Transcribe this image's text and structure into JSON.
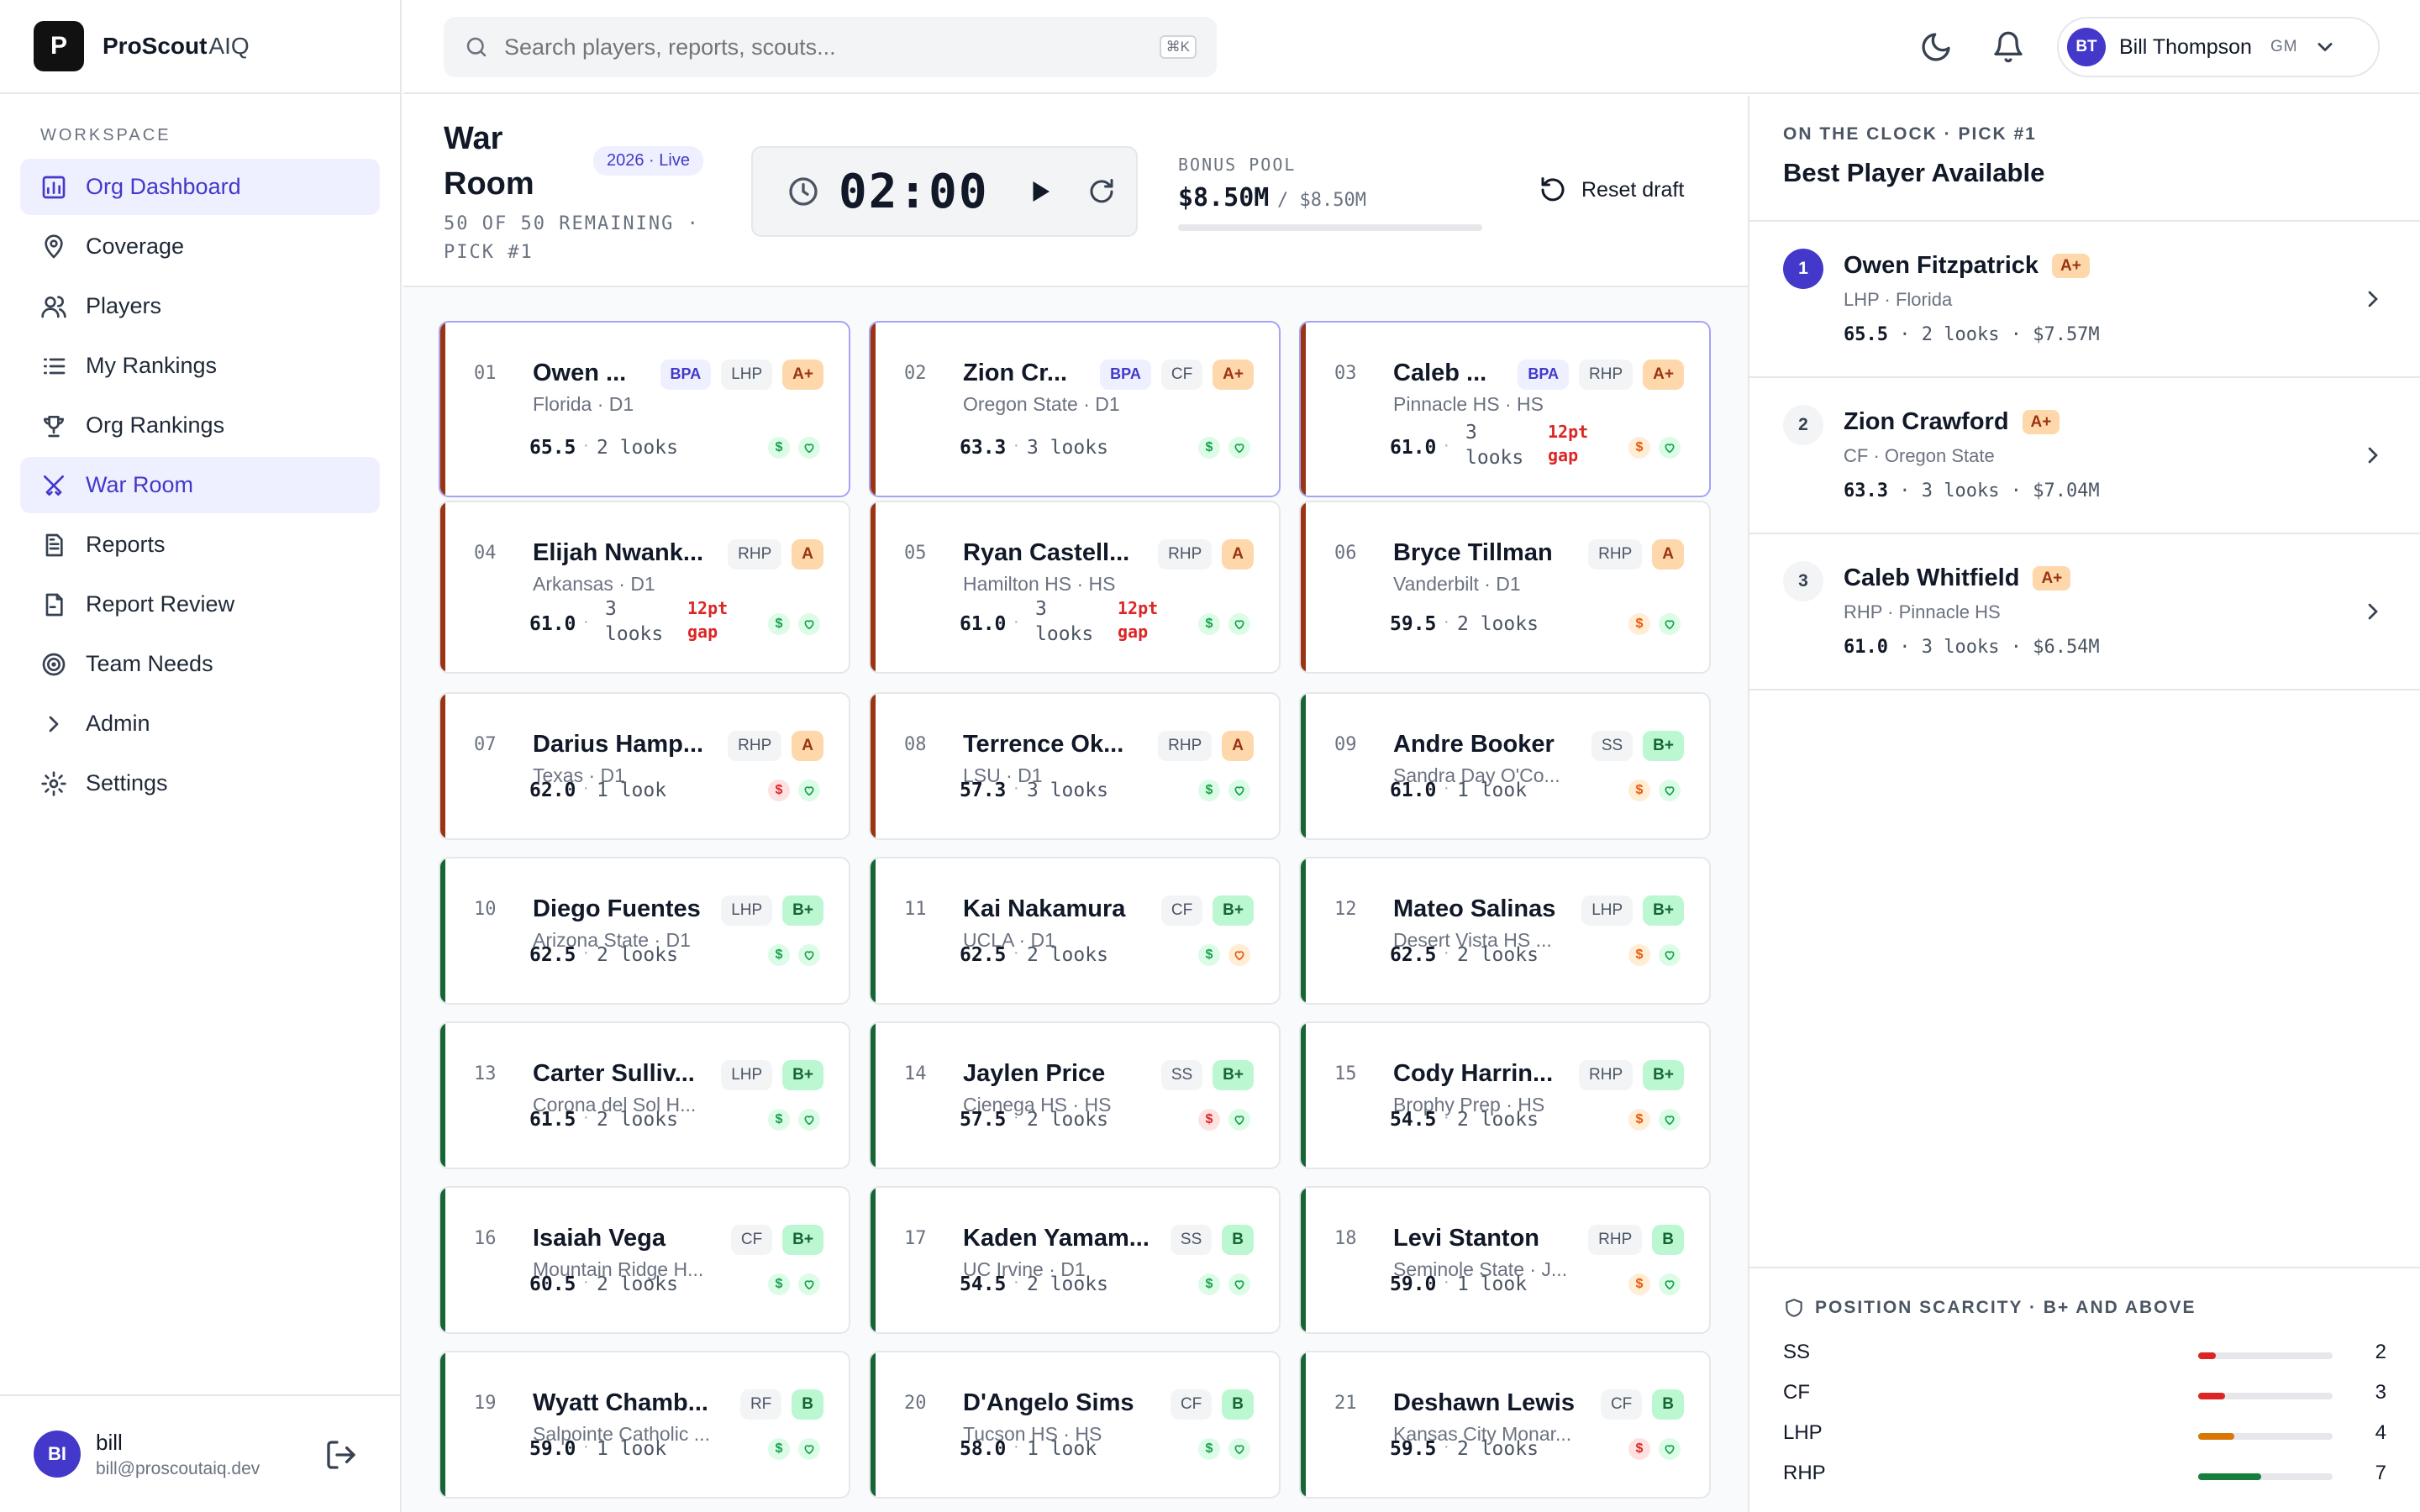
{
  "brand": {
    "logo_letter": "P",
    "name": "ProScout",
    "suffix": "AIQ"
  },
  "sidebar": {
    "section_label": "WORKSPACE",
    "items": [
      {
        "label": "Org Dashboard",
        "icon": "dashboard-icon",
        "active": true
      },
      {
        "label": "Coverage",
        "icon": "map-pin-icon",
        "active": false
      },
      {
        "label": "Players",
        "icon": "users-icon",
        "active": false
      },
      {
        "label": "My Rankings",
        "icon": "list-icon",
        "active": false
      },
      {
        "label": "Org Rankings",
        "icon": "trophy-icon",
        "active": false
      },
      {
        "label": "War Room",
        "icon": "crossed-swords-icon",
        "active": true
      },
      {
        "label": "Reports",
        "icon": "report-icon",
        "active": false
      },
      {
        "label": "Report Review",
        "icon": "file-review-icon",
        "active": false
      },
      {
        "label": "Team Needs",
        "icon": "target-icon",
        "active": false
      },
      {
        "label": "Admin",
        "icon": "chevron-right-icon",
        "active": false
      },
      {
        "label": "Settings",
        "icon": "gear-icon",
        "active": false
      }
    ],
    "user": {
      "initials": "BI",
      "name": "bill",
      "email": "bill@proscoutaiq.dev"
    }
  },
  "header": {
    "search_placeholder": "Search players, reports, scouts...",
    "search_shortcut": "⌘K",
    "user": {
      "initials": "BT",
      "name": "Bill Thompson",
      "role": "GM"
    }
  },
  "war_room": {
    "title": "War Room",
    "badge": "2026 · Live",
    "subtitle": "50 OF 50 REMAINING · PICK #1",
    "timer": "02:00",
    "bonus_label": "BONUS POOL",
    "bonus_value": "$8.50M",
    "bonus_total": "/ $8.50M",
    "bonus_remaining_fraction": 1.0,
    "reset_label": "Reset draft"
  },
  "players": [
    {
      "num": "01",
      "name": "Owen ...",
      "school": "Florida · D1",
      "bpa": "BPA",
      "pos": "LHP",
      "grade": "A+",
      "score": "65.5",
      "looks": "2 looks",
      "gap": "",
      "tier": "red",
      "money": "green",
      "heart": "green"
    },
    {
      "num": "02",
      "name": "Zion Cr...",
      "school": "Oregon State · D1",
      "bpa": "BPA",
      "pos": "CF",
      "grade": "A+",
      "score": "63.3",
      "looks": "3 looks",
      "gap": "",
      "tier": "red",
      "money": "green",
      "heart": "green"
    },
    {
      "num": "03",
      "name": "Caleb ...",
      "school": "Pinnacle HS · HS",
      "bpa": "BPA",
      "pos": "RHP",
      "grade": "A+",
      "score": "61.0",
      "looks": "3 looks",
      "gap": "12pt gap",
      "tier": "red",
      "money": "orange",
      "heart": "green"
    },
    {
      "num": "04",
      "name": "Elijah Nwank...",
      "school": "Arkansas · D1",
      "bpa": "",
      "pos": "RHP",
      "grade": "A",
      "score": "61.0",
      "looks": "3 looks",
      "gap": "12pt gap",
      "tier": "red",
      "money": "green",
      "heart": "green"
    },
    {
      "num": "05",
      "name": "Ryan Castell...",
      "school": "Hamilton HS · HS",
      "bpa": "",
      "pos": "RHP",
      "grade": "A",
      "score": "61.0",
      "looks": "3 looks",
      "gap": "12pt gap",
      "tier": "red",
      "money": "green",
      "heart": "green"
    },
    {
      "num": "06",
      "name": "Bryce Tillman",
      "school": "Vanderbilt · D1",
      "bpa": "",
      "pos": "RHP",
      "grade": "A",
      "score": "59.5",
      "looks": "2 looks",
      "gap": "",
      "tier": "red",
      "money": "orange",
      "heart": "green"
    },
    {
      "num": "07",
      "name": "Darius Hamp...",
      "school": "Texas · D1",
      "bpa": "",
      "pos": "RHP",
      "grade": "A",
      "score": "62.0",
      "looks": "1 look",
      "gap": "",
      "tier": "red",
      "money": "red",
      "heart": "green"
    },
    {
      "num": "08",
      "name": "Terrence Ok...",
      "school": "LSU · D1",
      "bpa": "",
      "pos": "RHP",
      "grade": "A",
      "score": "57.3",
      "looks": "3 looks",
      "gap": "",
      "tier": "red",
      "money": "green",
      "heart": "green"
    },
    {
      "num": "09",
      "name": "Andre Booker",
      "school": "Sandra Day O'Co...",
      "bpa": "",
      "pos": "SS",
      "grade": "B+",
      "score": "61.0",
      "looks": "1 look",
      "gap": "",
      "tier": "green",
      "money": "orange",
      "heart": "green"
    },
    {
      "num": "10",
      "name": "Diego Fuentes",
      "school": "Arizona State · D1",
      "bpa": "",
      "pos": "LHP",
      "grade": "B+",
      "score": "62.5",
      "looks": "2 looks",
      "gap": "",
      "tier": "green",
      "money": "green",
      "heart": "green"
    },
    {
      "num": "11",
      "name": "Kai Nakamura",
      "school": "UCLA · D1",
      "bpa": "",
      "pos": "CF",
      "grade": "B+",
      "score": "62.5",
      "looks": "2 looks",
      "gap": "",
      "tier": "green",
      "money": "green",
      "heart": "orange"
    },
    {
      "num": "12",
      "name": "Mateo Salinas",
      "school": "Desert Vista HS ...",
      "bpa": "",
      "pos": "LHP",
      "grade": "B+",
      "score": "62.5",
      "looks": "2 looks",
      "gap": "",
      "tier": "green",
      "money": "orange",
      "heart": "green"
    },
    {
      "num": "13",
      "name": "Carter Sulliv...",
      "school": "Corona del Sol H...",
      "bpa": "",
      "pos": "LHP",
      "grade": "B+",
      "score": "61.5",
      "looks": "2 looks",
      "gap": "",
      "tier": "green",
      "money": "green",
      "heart": "green"
    },
    {
      "num": "14",
      "name": "Jaylen Price",
      "school": "Cienega HS · HS",
      "bpa": "",
      "pos": "SS",
      "grade": "B+",
      "score": "57.5",
      "looks": "2 looks",
      "gap": "",
      "tier": "green",
      "money": "red",
      "heart": "green"
    },
    {
      "num": "15",
      "name": "Cody Harrin...",
      "school": "Brophy Prep · HS",
      "bpa": "",
      "pos": "RHP",
      "grade": "B+",
      "score": "54.5",
      "looks": "2 looks",
      "gap": "",
      "tier": "green",
      "money": "orange",
      "heart": "green"
    },
    {
      "num": "16",
      "name": "Isaiah Vega",
      "school": "Mountain Ridge H...",
      "bpa": "",
      "pos": "CF",
      "grade": "B+",
      "score": "60.5",
      "looks": "2 looks",
      "gap": "",
      "tier": "green",
      "money": "green",
      "heart": "green"
    },
    {
      "num": "17",
      "name": "Kaden Yamam...",
      "school": "UC Irvine · D1",
      "bpa": "",
      "pos": "SS",
      "grade": "B",
      "score": "54.5",
      "looks": "2 looks",
      "gap": "",
      "tier": "green",
      "money": "green",
      "heart": "green"
    },
    {
      "num": "18",
      "name": "Levi Stanton",
      "school": "Seminole State · J...",
      "bpa": "",
      "pos": "RHP",
      "grade": "B",
      "score": "59.0",
      "looks": "1 look",
      "gap": "",
      "tier": "green",
      "money": "orange",
      "heart": "green"
    },
    {
      "num": "19",
      "name": "Wyatt Chamb...",
      "school": "Salpointe Catholic ...",
      "bpa": "",
      "pos": "RF",
      "grade": "B",
      "score": "59.0",
      "looks": "1 look",
      "gap": "",
      "tier": "green",
      "money": "green",
      "heart": "green"
    },
    {
      "num": "20",
      "name": "D'Angelo Sims",
      "school": "Tucson HS · HS",
      "bpa": "",
      "pos": "CF",
      "grade": "B",
      "score": "58.0",
      "looks": "1 look",
      "gap": "",
      "tier": "green",
      "money": "green",
      "heart": "green"
    },
    {
      "num": "21",
      "name": "Deshawn Lewis",
      "school": "Kansas City Monar...",
      "bpa": "",
      "pos": "CF",
      "grade": "B",
      "score": "59.5",
      "looks": "2 looks",
      "gap": "",
      "tier": "green",
      "money": "red",
      "heart": "green"
    }
  ],
  "on_clock": {
    "label": "ON THE CLOCK · PICK #1",
    "title": "Best Player Available",
    "list": [
      {
        "rank": "1",
        "name": "Owen Fitzpatrick",
        "grade": "A+",
        "sub": "LHP · Florida",
        "score": "65.5",
        "looks": "2 looks",
        "bonus": "$7.57M"
      },
      {
        "rank": "2",
        "name": "Zion Crawford",
        "grade": "A+",
        "sub": "CF · Oregon State",
        "score": "63.3",
        "looks": "3 looks",
        "bonus": "$7.04M"
      },
      {
        "rank": "3",
        "name": "Caleb Whitfield",
        "grade": "A+",
        "sub": "RHP · Pinnacle HS",
        "score": "61.0",
        "looks": "3 looks",
        "bonus": "$6.54M"
      }
    ]
  },
  "scarcity": {
    "label": "POSITION SCARCITY · B+ AND ABOVE",
    "rows": [
      {
        "pos": "SS",
        "count": "2",
        "fraction": 0.13,
        "color": "#dc2626"
      },
      {
        "pos": "CF",
        "count": "3",
        "fraction": 0.2,
        "color": "#dc2626"
      },
      {
        "pos": "LHP",
        "count": "4",
        "fraction": 0.27,
        "color": "#d97706"
      },
      {
        "pos": "RHP",
        "count": "7",
        "fraction": 0.47,
        "color": "#15803d"
      }
    ]
  },
  "colors": {
    "accent": "#4338ca",
    "tier_red": "#9a3412",
    "tier_green": "#166534",
    "grade_a_bg": "#fed7aa",
    "grade_a_fg": "#9a3412",
    "grade_b_bg": "#bbf7d0",
    "grade_b_fg": "#166534"
  }
}
